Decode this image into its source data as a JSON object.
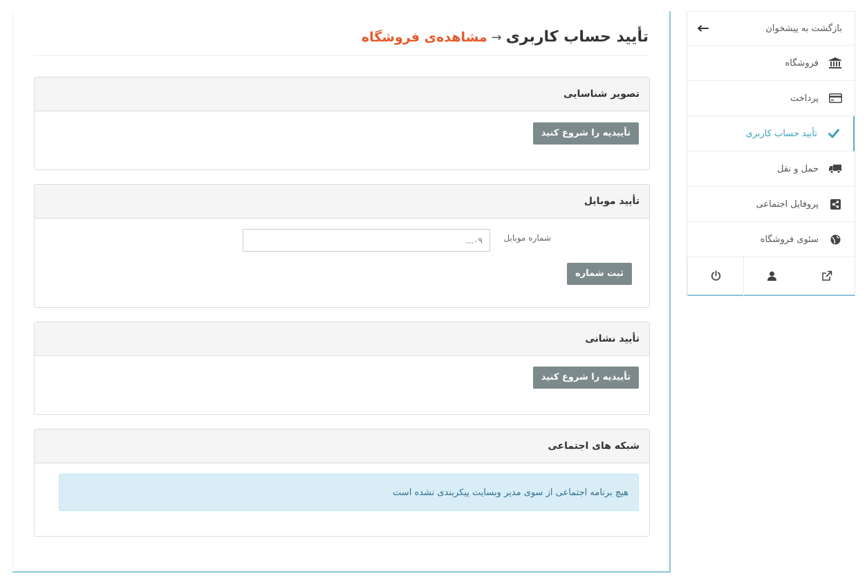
{
  "sidebar": {
    "back_label": "بازگشت به پیشخوان",
    "items": [
      {
        "label": "فروشگاه",
        "icon": "bank-icon"
      },
      {
        "label": "پرداخت",
        "icon": "credit-card-icon"
      },
      {
        "label": "تأیید حساب کاربری",
        "icon": "check-icon",
        "active": true
      },
      {
        "label": "حمل و نقل",
        "icon": "truck-icon"
      },
      {
        "label": "پروفایل اجتماعی",
        "icon": "share-icon"
      },
      {
        "label": "سئوی فروشگاه",
        "icon": "globe-icon"
      }
    ],
    "footer_icons": [
      "external-link-icon",
      "user-icon",
      "power-icon"
    ]
  },
  "page": {
    "title": "تأیید حساب کاربری",
    "separator": "→",
    "view_store_link": "مشاهده‌ی فروشگاه"
  },
  "panels": {
    "id_image": {
      "heading": "تصویر شناسایی",
      "button": "تأییدیه را شروع کنید"
    },
    "mobile": {
      "heading": "تأیید موبایل",
      "field_label": "شماره موبایل",
      "placeholder": "۰۹...",
      "button": "ثبت شماره"
    },
    "address": {
      "heading": "تأیید نشانی",
      "button": "تأییدیه را شروع کنید"
    },
    "social": {
      "heading": "شبکه های اجتماعی",
      "message": "هیچ برنامه اجتماعی از سوی مدیر وبسایت پیکربندی نشده است"
    }
  },
  "colors": {
    "accent": "#3aa2b7",
    "link": "#e55a2b",
    "button": "#7d8a8b",
    "alert_bg": "#d9edf7",
    "alert_text": "#31708f"
  }
}
